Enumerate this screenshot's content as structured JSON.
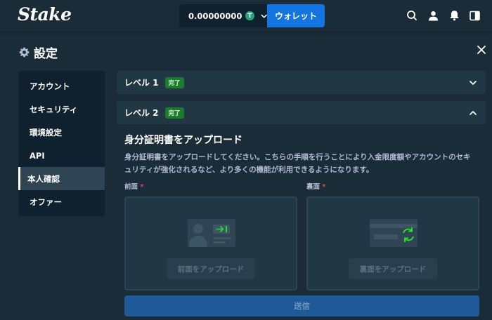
{
  "header": {
    "logo": "Stake",
    "balance": "0.00000000",
    "coin_symbol": "T",
    "wallet_button": "ウォレット",
    "icons": [
      "search-icon",
      "user-icon",
      "bell-icon",
      "sidebar-toggle-icon"
    ]
  },
  "page": {
    "title": "設定"
  },
  "sidebar": {
    "items": [
      {
        "label": "アカウント"
      },
      {
        "label": "セキュリティ"
      },
      {
        "label": "環境設定"
      },
      {
        "label": "API"
      },
      {
        "label": "本人確認"
      },
      {
        "label": "オファー"
      }
    ],
    "active_index": 4
  },
  "levels": {
    "level1": {
      "label": "レベル 1",
      "badge": "完了"
    },
    "level2": {
      "label": "レベル 2",
      "badge": "完了",
      "section_title": "身分証明書をアップロード",
      "description": "身分証明書をアップロードしてください。こちらの手順を行うことにより入金限度額やアカウントのセキュリティが強化されるなど、より多くの機能が利用できるようになります。",
      "front_label": "前面",
      "back_label": "裏面",
      "required_mark": "*",
      "front_upload": "前面をアップロード",
      "back_upload": "裏面をアップロード",
      "submit": "送信"
    }
  },
  "colors": {
    "background": "#1a2c38",
    "panel": "#213743",
    "accent": "#1475e1",
    "badge_green": "#1d7a2f"
  }
}
